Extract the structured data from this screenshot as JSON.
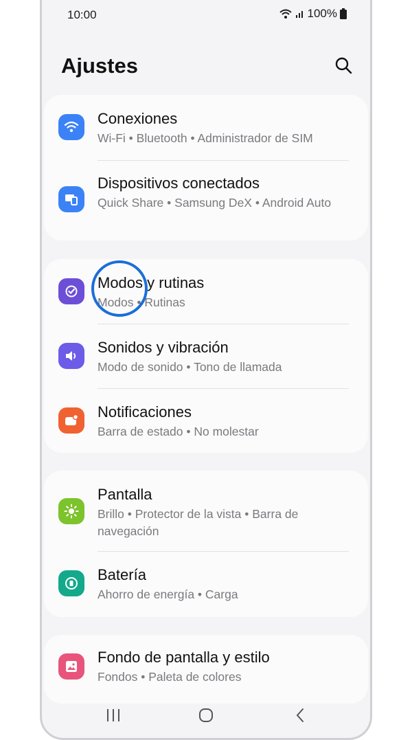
{
  "status": {
    "time": "10:00",
    "battery": "100%"
  },
  "header": {
    "title": "Ajustes"
  },
  "groups": [
    {
      "items": [
        {
          "title": "Conexiones",
          "subtitle": "Wi-Fi  •  Bluetooth  •  Administrador de SIM",
          "icon": "wifi-icon",
          "color": "#3b82f6"
        },
        {
          "title": "Dispositivos conectados",
          "subtitle": "Quick Share  •  Samsung DeX  •  Android Auto",
          "icon": "devices-icon",
          "color": "#3b82f6"
        }
      ]
    },
    {
      "items": [
        {
          "title": "Modos y rutinas",
          "subtitle": "Modos  •  Rutinas",
          "icon": "modes-icon",
          "color": "#6c4fd6"
        },
        {
          "title": "Sonidos y vibración",
          "subtitle": "Modo de sonido  •  Tono de llamada",
          "icon": "sound-icon",
          "color": "#6c5ce7"
        },
        {
          "title": "Notificaciones",
          "subtitle": "Barra de estado  •  No molestar",
          "icon": "notification-icon",
          "color": "#f06231"
        }
      ]
    },
    {
      "items": [
        {
          "title": "Pantalla",
          "subtitle": "Brillo  •  Protector de la vista  •  Barra de navegación",
          "icon": "display-icon",
          "color": "#7cc32c"
        },
        {
          "title": "Batería",
          "subtitle": "Ahorro de energía  •  Carga",
          "icon": "battery-icon",
          "color": "#14a98b"
        }
      ]
    },
    {
      "items": [
        {
          "title": "Fondo de pantalla y estilo",
          "subtitle": "Fondos  •  Paleta de colores",
          "icon": "wallpaper-icon",
          "color": "#e9547b"
        }
      ]
    }
  ],
  "highlight": {
    "color": "#1a6ed8"
  }
}
